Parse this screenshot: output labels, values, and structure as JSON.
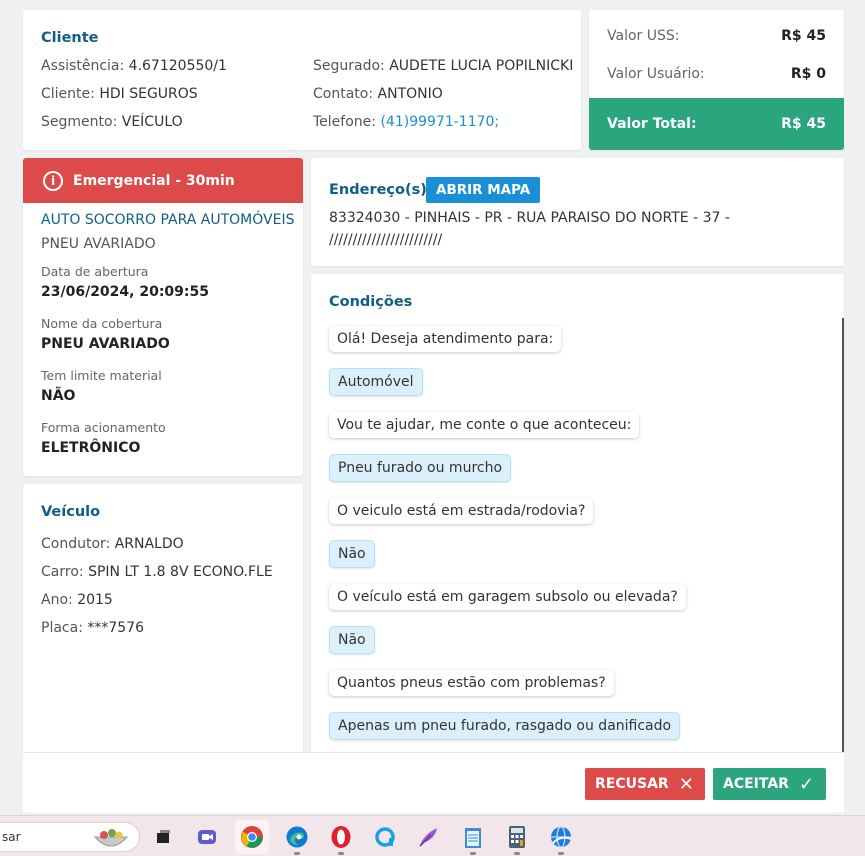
{
  "cliente": {
    "title": "Cliente",
    "assistencia_label": "Assistência:",
    "assistencia_value": "4.67120550/1",
    "cliente_label": "Cliente:",
    "cliente_value": "HDI SEGUROS",
    "segmento_label": "Segmento:",
    "segmento_value": "VEÍCULO",
    "segurado_label": "Segurado:",
    "segurado_value": "AUDETE LUCIA POPILNICKI",
    "contato_label": "Contato:",
    "contato_value": "ANTONIO",
    "telefone_label": "Telefone:",
    "telefone_value": "(41)99971-1170;"
  },
  "valores": {
    "uss_label": "Valor USS:",
    "uss_value": "R$ 45",
    "usuario_label": "Valor Usuário:",
    "usuario_value": "R$ 0",
    "total_label": "Valor Total:",
    "total_value": "R$ 45"
  },
  "servico": {
    "banner": "Emergencial - 30min",
    "tipo": "AUTO SOCORRO PARA AUTOMÓVEIS",
    "subtipo": "PNEU AVARIADO",
    "data_label": "Data de abertura",
    "data_value": "23/06/2024, 20:09:55",
    "cobertura_label": "Nome da cobertura",
    "cobertura_value": "PNEU AVARIADO",
    "limite_label": "Tem limite material",
    "limite_value": "NÃO",
    "forma_label": "Forma acionamento",
    "forma_value": "ELETRÔNICO"
  },
  "veiculo": {
    "title": "Veículo",
    "condutor_label": "Condutor:",
    "condutor_value": "ARNALDO",
    "carro_label": "Carro:",
    "carro_value": "SPIN LT 1.8 8V ECONO.FLE",
    "ano_label": "Ano:",
    "ano_value": "2015",
    "placa_label": "Placa:",
    "placa_value": "***7576"
  },
  "endereco": {
    "title": "Endereço(s)",
    "map_button": "ABRIR MAPA",
    "line1": "83324030 - PINHAIS - PR - RUA PARAISO DO NORTE - 37 -",
    "line2": "////////////////////////"
  },
  "condicoes": {
    "title": "Condições",
    "messages": [
      {
        "text": "Olá! Deseja atendimento para:",
        "kind": "question"
      },
      {
        "text": "Automóvel",
        "kind": "answer"
      },
      {
        "text": "Vou te ajudar, me conte o que aconteceu:",
        "kind": "question"
      },
      {
        "text": "Pneu furado ou murcho",
        "kind": "answer"
      },
      {
        "text": "O veiculo está em estrada/rodovia?",
        "kind": "question"
      },
      {
        "text": "Não",
        "kind": "answer"
      },
      {
        "text": "O veículo está em garagem subsolo ou elevada?",
        "kind": "question"
      },
      {
        "text": "Não",
        "kind": "answer"
      },
      {
        "text": "Quantos pneus estão com problemas?",
        "kind": "question"
      },
      {
        "text": "Apenas um pneu furado, rasgado ou danificado",
        "kind": "answer"
      }
    ]
  },
  "actions": {
    "recusar": "RECUSAR",
    "aceitar": "ACEITAR"
  },
  "taskbar": {
    "search_text": "sar"
  },
  "colors": {
    "accent_blue": "#1a8fd6",
    "danger_red": "#dd4a4a",
    "success_green": "#2aa57e",
    "title_blue": "#0f5e8a"
  }
}
